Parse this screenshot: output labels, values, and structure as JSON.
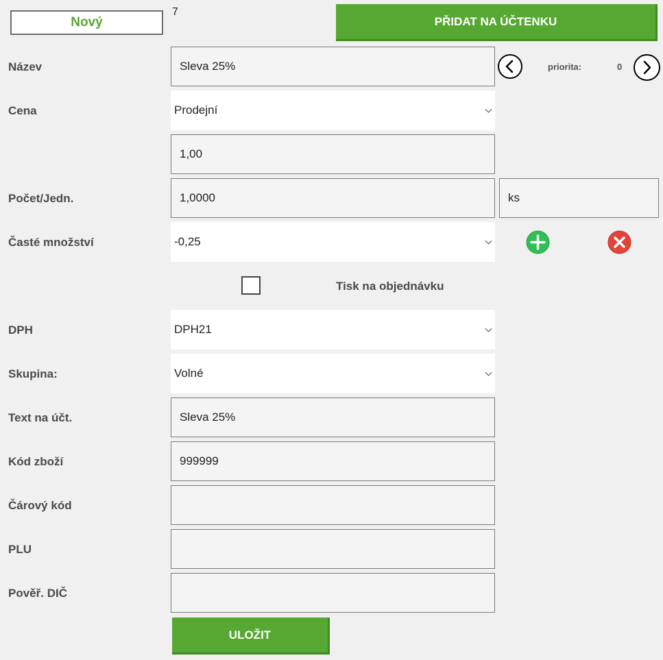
{
  "header": {
    "new_label": "Nový",
    "count": "7",
    "add_to_receipt_label": "PŘIDAT NA ÚČTENKU"
  },
  "priority": {
    "label": "priorita:",
    "value": "0"
  },
  "form": {
    "name_label": "Název",
    "name_value": "Sleva 25%",
    "price_label": "Cena",
    "price_type_selected": "Prodejní",
    "price_value": "1,00",
    "quantity_label": "Počet/Jedn.",
    "quantity_value": "1,0000",
    "unit_value": "ks",
    "frequent_qty_label": "Časté množství",
    "frequent_qty_selected": "-0,25",
    "print_order_label": "Tisk na objednávku",
    "print_order_checked": false,
    "vat_label": "DPH",
    "vat_selected": "DPH21",
    "group_label": "Skupina:",
    "group_selected": "Volné",
    "receipt_text_label": "Text na účt.",
    "receipt_text_value": "Sleva 25%",
    "product_code_label": "Kód zboží",
    "product_code_value": "999999",
    "barcode_label": "Čárový kód",
    "barcode_value": "",
    "plu_label": "PLU",
    "plu_value": "",
    "tax_id_label": "Pověř. DIČ",
    "tax_id_value": ""
  },
  "footer": {
    "save_label": "ULOŽIT"
  },
  "colors": {
    "accent_green": "#57a832",
    "add_icon_green": "#2fbf55",
    "remove_icon_red": "#e0443a"
  },
  "icons": [
    "chevron-left-icon",
    "chevron-right-icon",
    "plus-circle-icon",
    "close-circle-icon",
    "chevron-down-icon"
  ]
}
